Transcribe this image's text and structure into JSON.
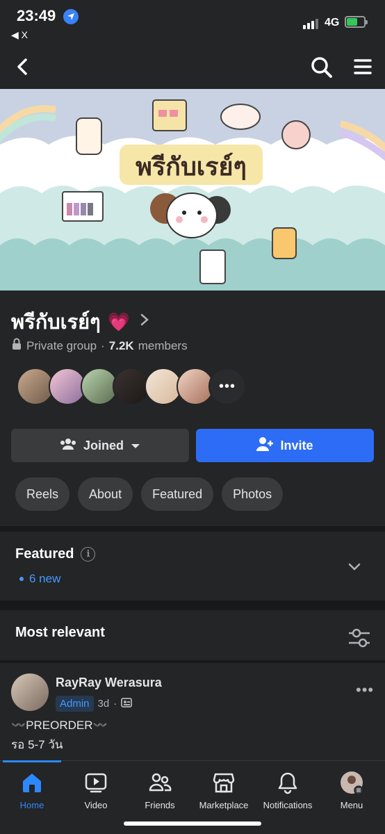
{
  "status_bar": {
    "time": "23:49",
    "back_app": "◀ X",
    "network": "4G"
  },
  "group": {
    "name": "พรีกับเรย์ๆ",
    "privacy": "Private group",
    "member_count": "7.2K",
    "members_label": "members",
    "cover_title": "พรีกับเรย์ๆ"
  },
  "actions": {
    "joined_label": "Joined",
    "invite_label": "Invite"
  },
  "chips": [
    "Reels",
    "About",
    "Featured",
    "Photos"
  ],
  "featured": {
    "title": "Featured",
    "new_label": "6 new"
  },
  "feed": {
    "sort_label": "Most relevant"
  },
  "post": {
    "author": "RayRay Werasura",
    "badge": "Admin",
    "time": "3d",
    "line1": "〰️PREORDER〰️",
    "line2": "รอ 5-7 วัน"
  },
  "tabs": [
    {
      "label": "Home",
      "icon": "home-icon",
      "active": true
    },
    {
      "label": "Video",
      "icon": "video-icon"
    },
    {
      "label": "Friends",
      "icon": "friends-icon"
    },
    {
      "label": "Marketplace",
      "icon": "marketplace-icon"
    },
    {
      "label": "Notifications",
      "icon": "bell-icon"
    },
    {
      "label": "Menu",
      "icon": "profile-menu-icon"
    }
  ],
  "colors": {
    "background": "#242526",
    "accent_blue": "#2d6cf5",
    "link_blue": "#4599ff",
    "heart_pink": "#ff4fa3"
  }
}
